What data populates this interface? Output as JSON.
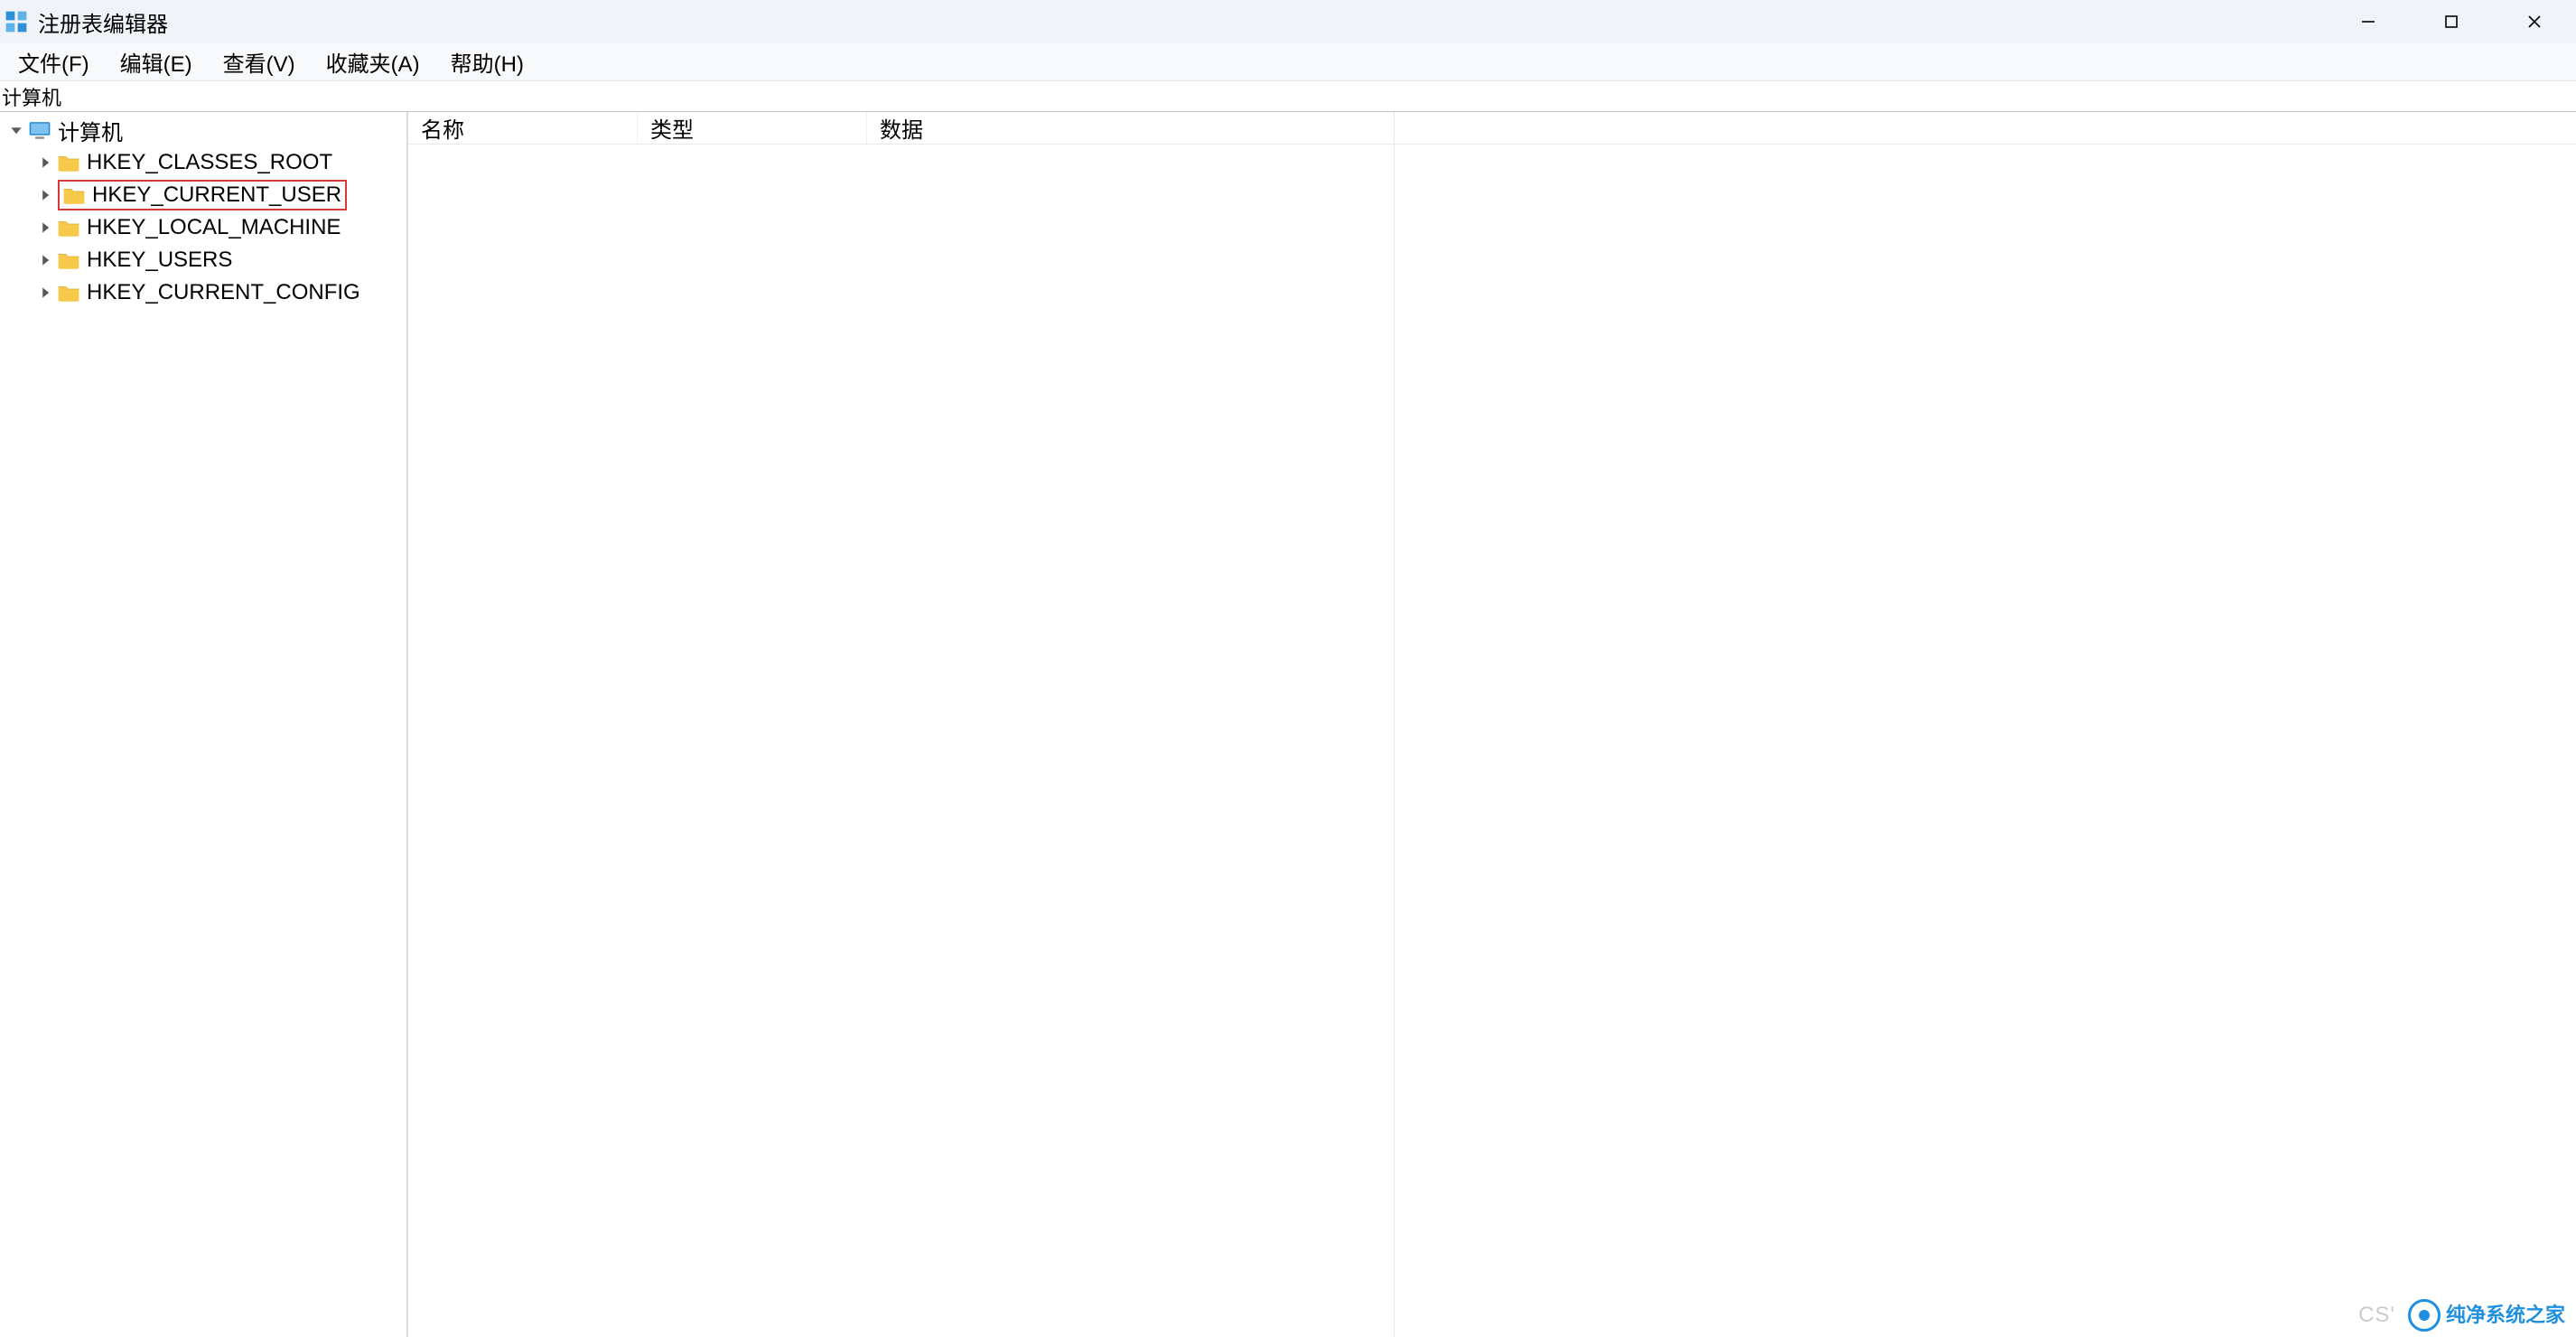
{
  "window": {
    "title": "注册表编辑器"
  },
  "menu": {
    "file": "文件(F)",
    "edit": "编辑(E)",
    "view": "查看(V)",
    "fav": "收藏夹(A)",
    "help": "帮助(H)"
  },
  "pathbar": {
    "value": "计算机"
  },
  "tree": {
    "root_label": "计算机",
    "children": [
      {
        "label": "HKEY_CLASSES_ROOT",
        "highlighted": false
      },
      {
        "label": "HKEY_CURRENT_USER",
        "highlighted": true
      },
      {
        "label": "HKEY_LOCAL_MACHINE",
        "highlighted": false
      },
      {
        "label": "HKEY_USERS",
        "highlighted": false
      },
      {
        "label": "HKEY_CURRENT_CONFIG",
        "highlighted": false
      }
    ]
  },
  "list": {
    "columns": {
      "name": "名称",
      "type": "类型",
      "data": "数据"
    }
  },
  "watermark": {
    "cs": "CS'",
    "brand": "纯净系统之家"
  },
  "icons": {
    "registry_app": "registry-icon",
    "computer": "computer-icon",
    "folder": "folder-icon",
    "chevron_down": "chevron-down-icon",
    "chevron_right": "chevron-right-icon",
    "minimize": "minimize-icon",
    "maximize": "maximize-icon",
    "close": "close-icon"
  }
}
